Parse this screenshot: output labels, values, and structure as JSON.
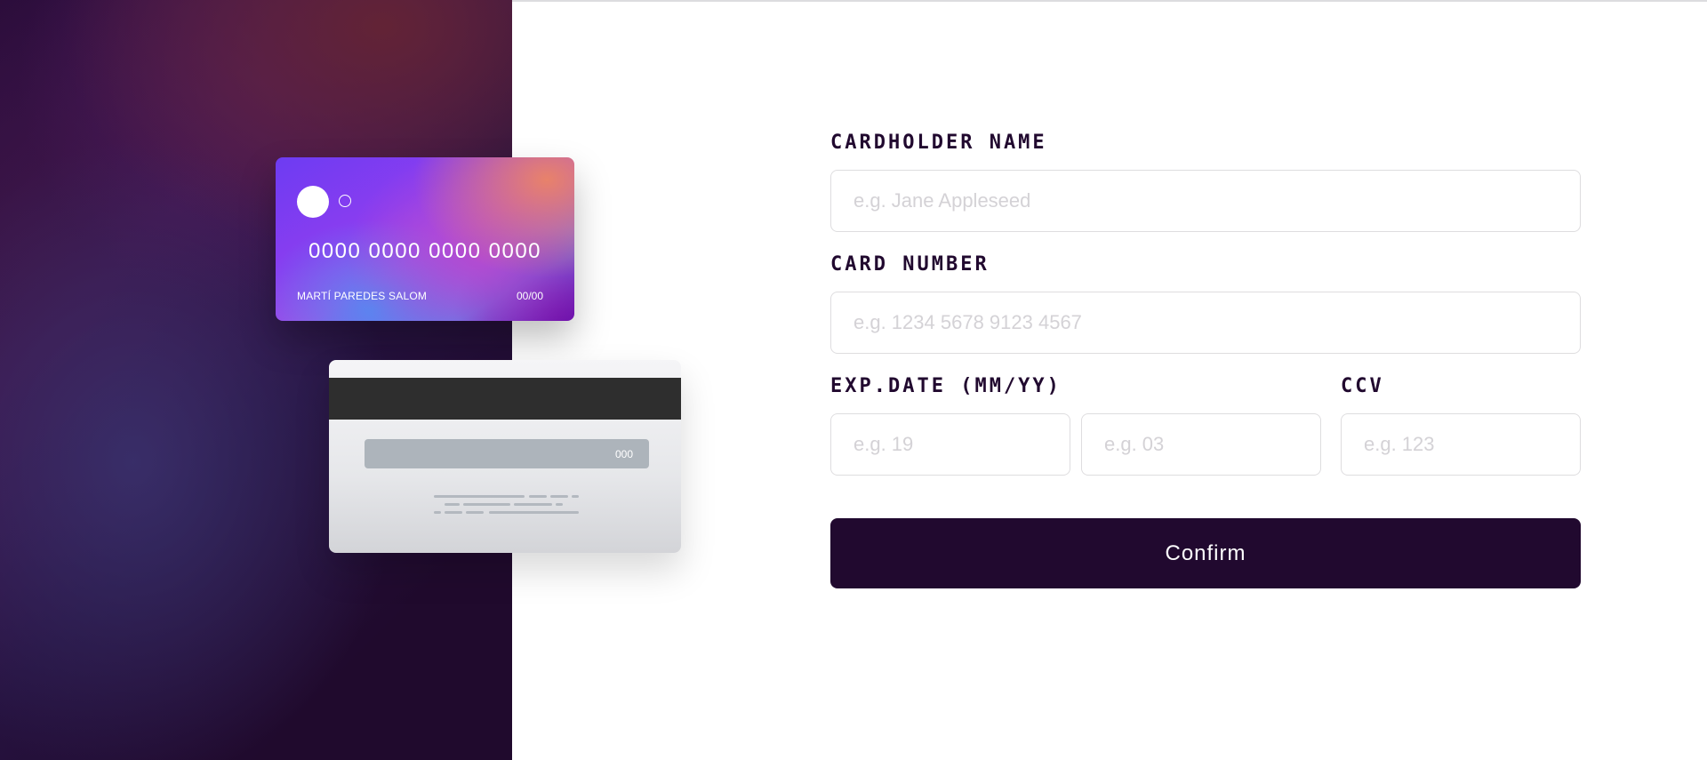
{
  "card_front": {
    "number": "0000 0000 0000 0000",
    "holder_name": "MARTÍ PAREDES SALOM",
    "expiry": "00/00"
  },
  "card_back": {
    "cvc": "000"
  },
  "form": {
    "cardholder_label": "CARDHOLDER NAME",
    "cardholder_placeholder": "e.g. Jane Appleseed",
    "number_label": "CARD NUMBER",
    "number_placeholder": "e.g. 1234 5678 9123 4567",
    "exp_label": "EXP.DATE (MM/YY)",
    "exp_month_placeholder": "e.g. 19",
    "exp_year_placeholder": "e.g. 03",
    "cvc_label": "CCV",
    "cvc_placeholder": "e.g. 123",
    "confirm_label": "Confirm"
  },
  "colors": {
    "dark_violet": "#21092f",
    "border": "#dedddf",
    "placeholder": "#d4d2d6"
  }
}
